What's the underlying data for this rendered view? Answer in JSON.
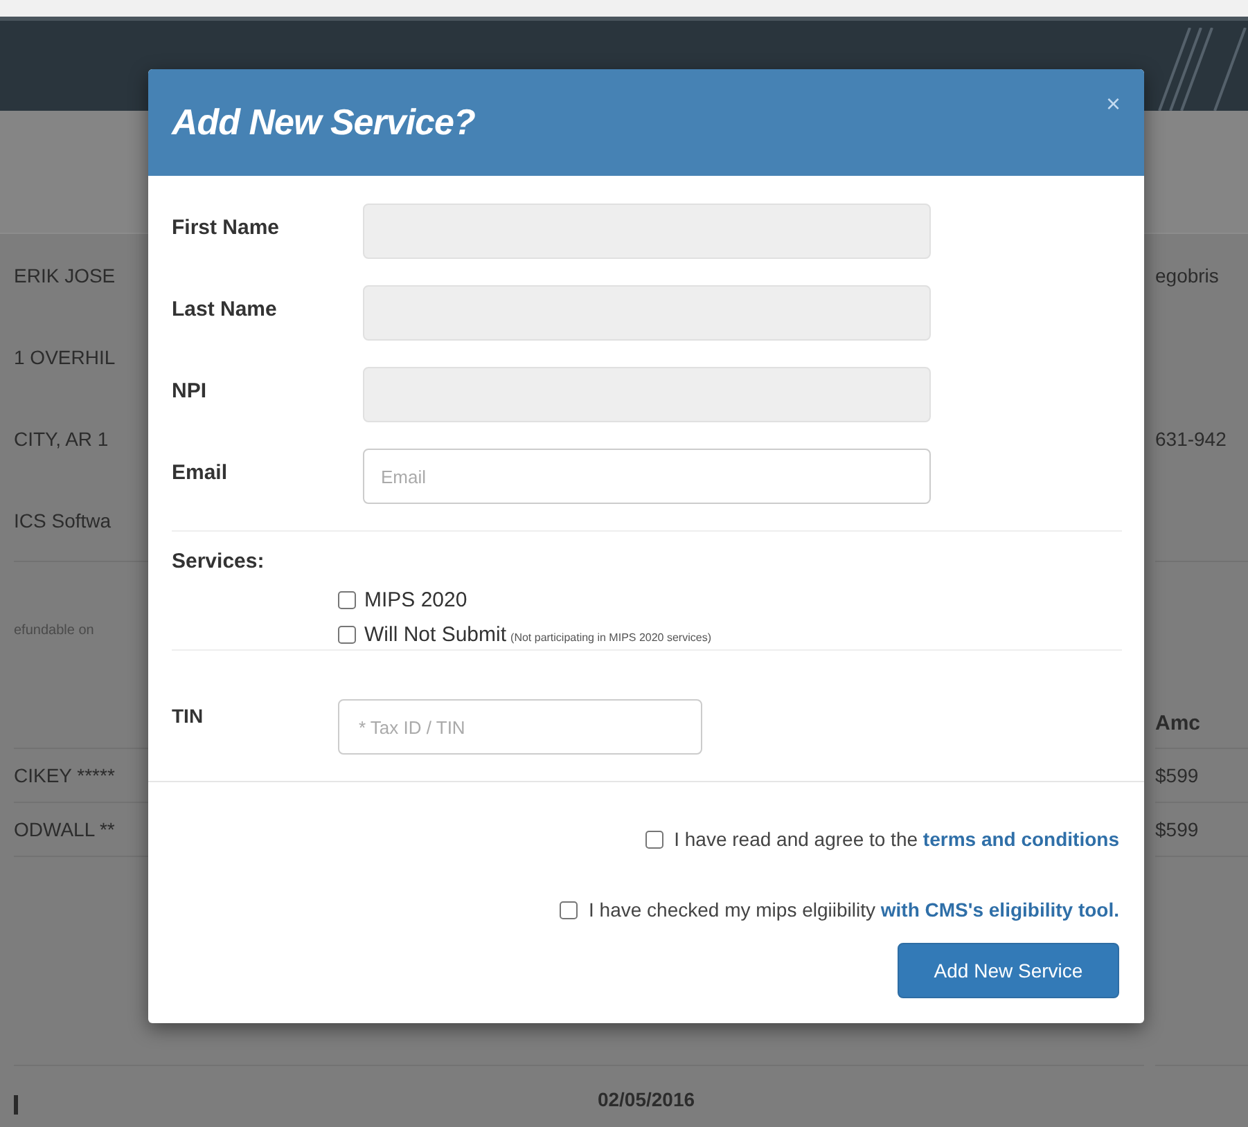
{
  "background": {
    "details_left": [
      "ERIK JOSE",
      "1 OVERHIL",
      "CITY, AR 1",
      "ICS Softwa"
    ],
    "email": "egobris",
    "phone": "631-942",
    "note": "efundable on",
    "table": {
      "column_2_header": "Amc",
      "rows": [
        {
          "column_1": "CIKEY *****",
          "column_2": "$599"
        },
        {
          "column_1": "ODWALL **",
          "column_2": "$599"
        }
      ]
    },
    "date": "02/05/2016"
  },
  "modal": {
    "title": "Add New Service?",
    "close": "×",
    "fields": [
      {
        "label": "First Name",
        "disabled": true
      },
      {
        "label": "Last Name",
        "disabled": true
      },
      {
        "label": "NPI",
        "disabled": true
      },
      {
        "label": "Email",
        "disabled": false,
        "placeholder": "Email"
      }
    ],
    "services": {
      "label": "Services:",
      "options": [
        {
          "label": "MIPS 2020",
          "checked": false
        },
        {
          "label": "Will Not Submit",
          "note": "(Not participating in MIPS 2020 services)",
          "checked": false
        }
      ]
    },
    "tin": {
      "label": "TIN",
      "placeholder": "* Tax ID / TIN"
    },
    "agreements": [
      {
        "text": "I have read and agree to the ",
        "link": "terms and conditions",
        "checked": false
      },
      {
        "text": "I have checked my mips elgiibility ",
        "link": "with CMS's eligibility tool.",
        "checked": false
      }
    ],
    "submit": "Add New Service"
  }
}
